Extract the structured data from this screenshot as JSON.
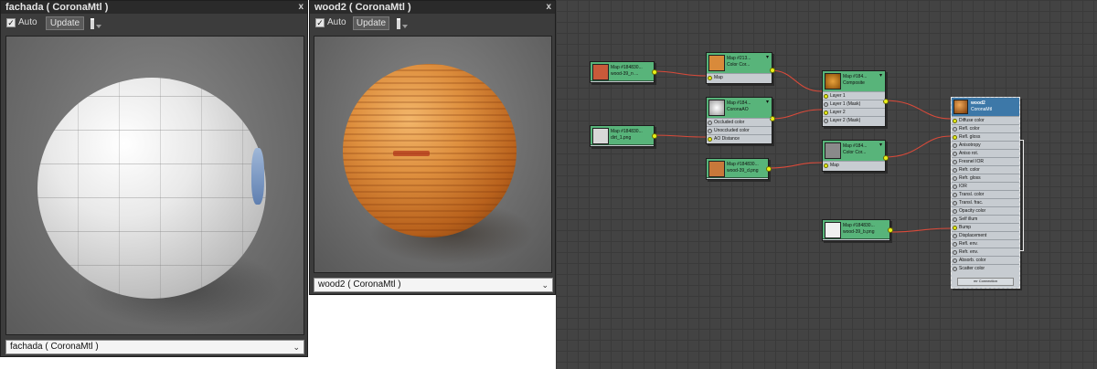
{
  "panel_left": {
    "title": "fachada  ( CoronaMtl )",
    "close": "x",
    "auto_label": "Auto",
    "auto_checked": "✓",
    "update_label": "Update",
    "dropdown_value": "fachada  ( CoronaMtl )",
    "chevron": "⌄"
  },
  "panel_right": {
    "title": "wood2  ( CoronaMtl )",
    "close": "x",
    "auto_label": "Auto",
    "auto_checked": "✓",
    "update_label": "Update",
    "dropdown_value": "wood2  ( CoronaMtl )",
    "chevron": "⌄"
  },
  "nodes": {
    "map_wood39n": {
      "t1": "Map #184830...",
      "t2": "wood-39_n ...",
      "thumb": "#c85a3a"
    },
    "map_dirt": {
      "t1": "Map #184830...",
      "t2": "dirt_1.png",
      "thumb": "#d8d8d8"
    },
    "color_corr1": {
      "t1": "Map #213...",
      "t2": "Color Cor...",
      "thumb": "#d98a3a",
      "menu": "▾",
      "rows": [
        "Map"
      ]
    },
    "corona_ao": {
      "t1": "Map #184...",
      "t2": "CoronaAO",
      "thumb": "#e8e8e8",
      "menu": "▾",
      "rows": [
        "Occluded color",
        "Unoccluded color",
        "AO Distance"
      ]
    },
    "map_wood39d": {
      "t1": "Map #184830...",
      "t2": "wood-39_d.png",
      "thumb": "#c8783a"
    },
    "composite": {
      "t1": "Map #184...",
      "t2": "Composite",
      "thumb": "#c8841c",
      "menu": "▾",
      "rows": [
        "Layer 1",
        "Layer 1 (Mask)",
        "Layer 2",
        "Layer 2 (Mask)"
      ]
    },
    "color_corr2": {
      "t1": "Map #184...",
      "t2": "Color Cor...",
      "thumb": "#8a8a8a",
      "menu": "▾",
      "rows": [
        "Map"
      ]
    },
    "map_wood39b": {
      "t1": "Map #184830...",
      "t2": "wood-39_b.png",
      "thumb": "#f0f0f0"
    },
    "wood2_mtl": {
      "t1": "wood2",
      "t2": "CoronaMtl",
      "thumb": "#b8641c",
      "rows": [
        "Diffuse color",
        "Refl. color",
        "Refl. gloss",
        "Anisotropy",
        "Aniso rot.",
        "Fresnel IOR",
        "Refr. color",
        "Refr. gloss",
        "IOR",
        "Transl. color",
        "Transl. frac.",
        "Opacity color",
        "Self illum",
        "Bump",
        "Displacement",
        "Refl. env.",
        "Refr. env.",
        "Absorb. color",
        "Scatter color"
      ],
      "footer": "mr Connection"
    }
  }
}
